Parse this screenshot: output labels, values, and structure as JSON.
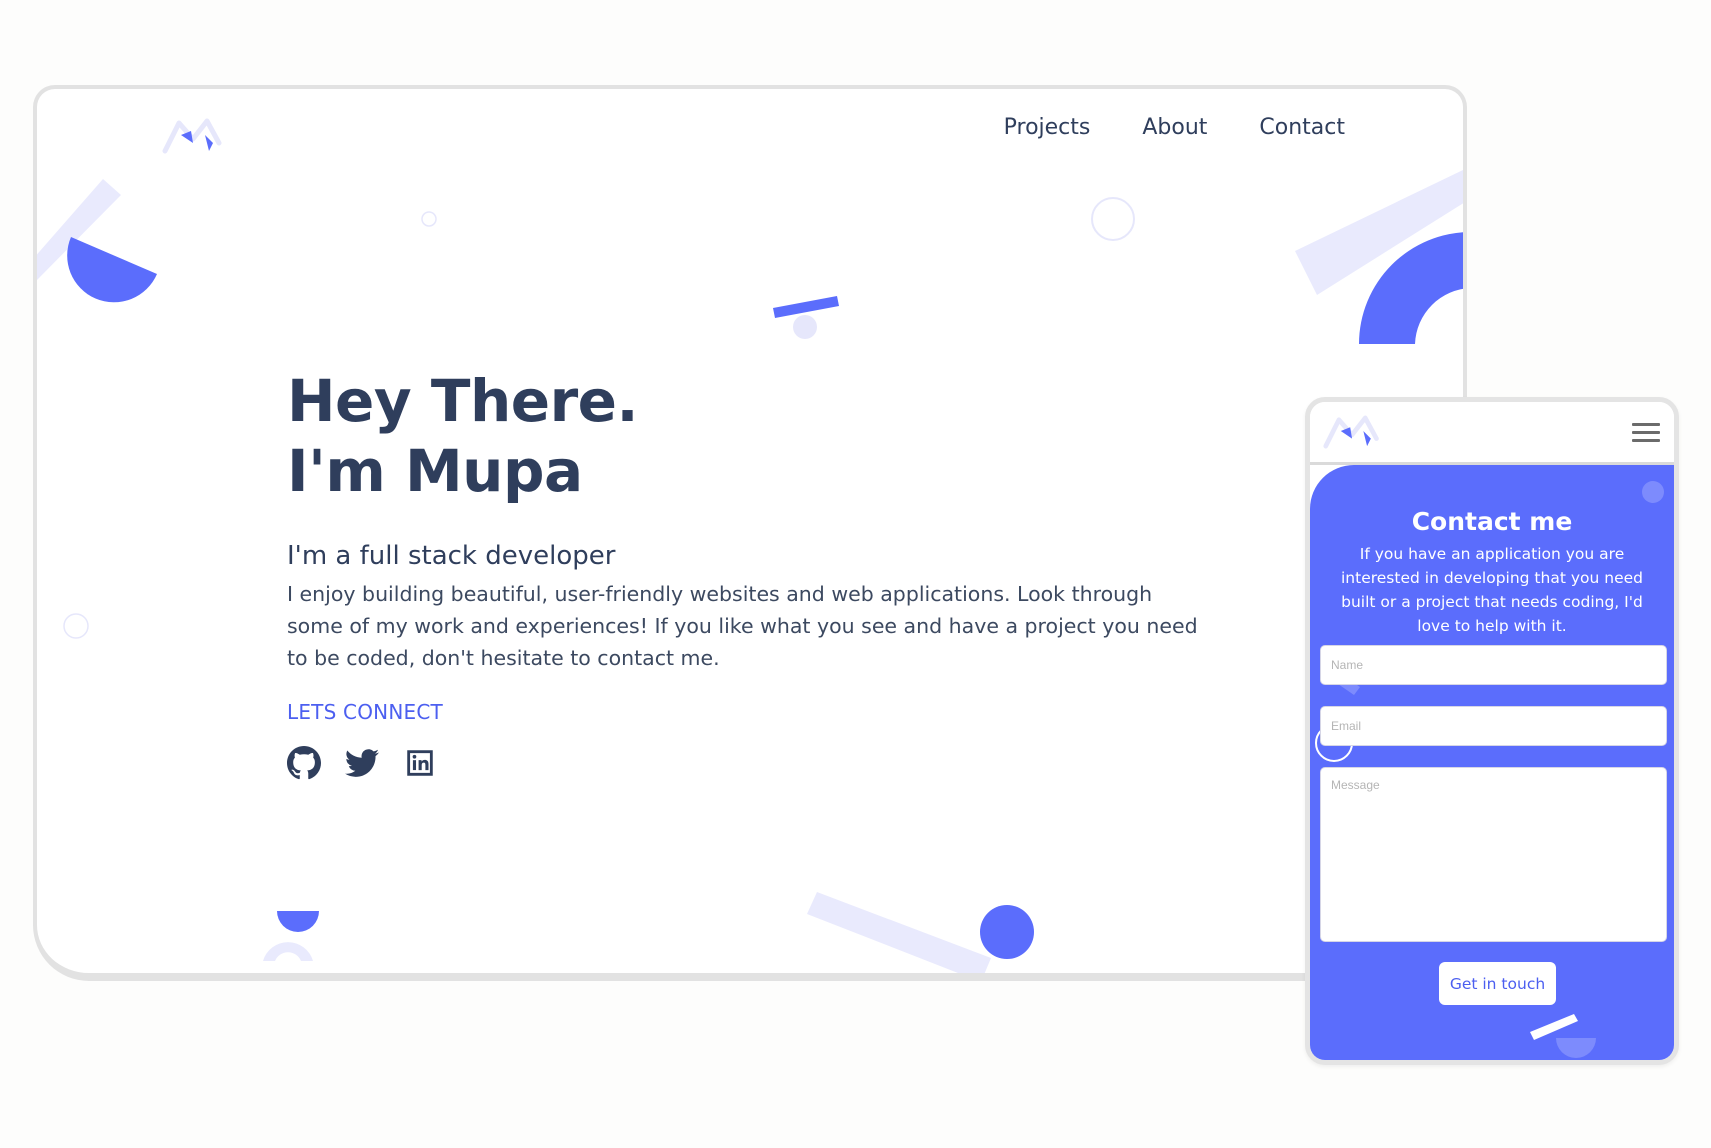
{
  "colors": {
    "accent": "#5b6dfc",
    "accent_light": "#e9eafd",
    "text_dark": "#2f3e5c",
    "link": "#4c5ff0",
    "page_background": "#fdfdfc"
  },
  "desktop": {
    "logo": {
      "icon": "m-logo-icon"
    },
    "nav": {
      "items": [
        {
          "label": "Projects"
        },
        {
          "label": "About"
        },
        {
          "label": "Contact"
        }
      ]
    },
    "hero": {
      "title_line1": "Hey There.",
      "title_line2": "I'm Mupa",
      "subtitle": "I'm a full stack developer",
      "description": "I enjoy building beautiful, user-friendly websites and web applications. Look through some of my work and experiences! If you like what you see and have a project you need to be coded, don't hesitate to contact me.",
      "cta_label": "LETS CONNECT",
      "socials": [
        {
          "icon": "github-icon"
        },
        {
          "icon": "twitter-icon"
        },
        {
          "icon": "linkedin-icon"
        }
      ]
    }
  },
  "mobile": {
    "logo": {
      "icon": "m-logo-icon"
    },
    "menu_icon": "hamburger-menu-icon",
    "contact": {
      "title": "Contact me",
      "description": "If you have an application you are interested in developing that you need built or a project that needs coding, I'd love to help with it.",
      "name_placeholder": "Name",
      "email_placeholder": "Email",
      "message_placeholder": "Message",
      "submit_label": "Get in touch"
    }
  }
}
